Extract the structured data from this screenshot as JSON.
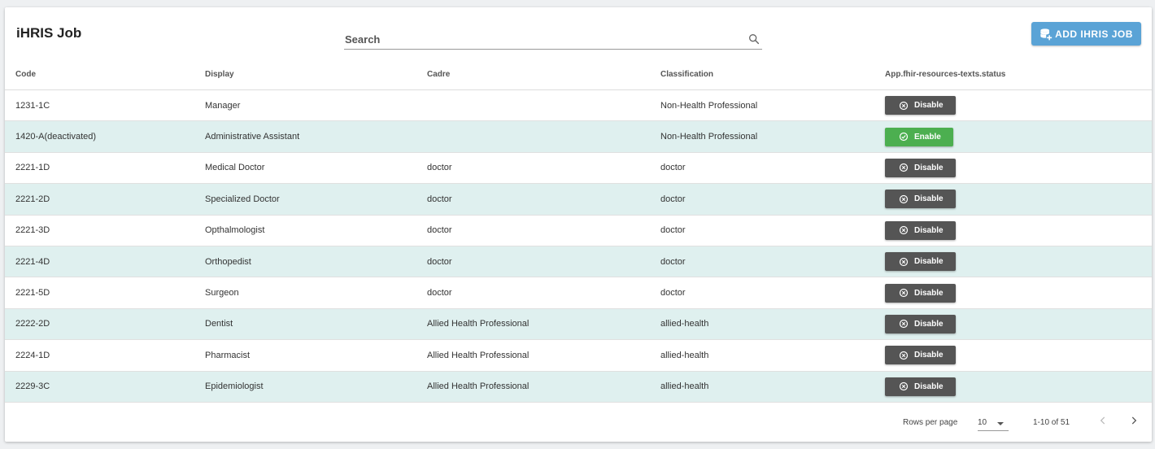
{
  "header": {
    "title": "iHRIS Job",
    "search_label": "Search",
    "add_button_label": "ADD IHRIS JOB"
  },
  "table": {
    "columns": [
      "Code",
      "Display",
      "Cadre",
      "Classification",
      "App.fhir-resources-texts.status"
    ],
    "rows": [
      {
        "code": "1231-1C",
        "display": "Manager",
        "cadre": "",
        "classification": "Non-Health Professional",
        "action": "Disable"
      },
      {
        "code": "1420-A(deactivated)",
        "display": "Administrative Assistant",
        "cadre": "",
        "classification": "Non-Health Professional",
        "action": "Enable"
      },
      {
        "code": "2221-1D",
        "display": "Medical Doctor",
        "cadre": "doctor",
        "classification": "doctor",
        "action": "Disable"
      },
      {
        "code": "2221-2D",
        "display": "Specialized Doctor",
        "cadre": "doctor",
        "classification": "doctor",
        "action": "Disable"
      },
      {
        "code": "2221-3D",
        "display": "Opthalmologist",
        "cadre": "doctor",
        "classification": "doctor",
        "action": "Disable"
      },
      {
        "code": "2221-4D",
        "display": "Orthopedist",
        "cadre": "doctor",
        "classification": "doctor",
        "action": "Disable"
      },
      {
        "code": "2221-5D",
        "display": "Surgeon",
        "cadre": "doctor",
        "classification": "doctor",
        "action": "Disable"
      },
      {
        "code": "2222-2D",
        "display": "Dentist",
        "cadre": "Allied Health Professional",
        "classification": "allied-health",
        "action": "Disable"
      },
      {
        "code": "2224-1D",
        "display": "Pharmacist",
        "cadre": "Allied Health Professional",
        "classification": "allied-health",
        "action": "Disable"
      },
      {
        "code": "2229-3C",
        "display": "Epidemiologist",
        "cadre": "Allied Health Professional",
        "classification": "allied-health",
        "action": "Disable"
      }
    ]
  },
  "footer": {
    "rows_per_page_label": "Rows per page",
    "rows_per_page_value": "10",
    "range_text": "1-10 of 51"
  },
  "colors": {
    "accent": "#5aa3d6",
    "row_alt": "#dff0ef",
    "disable_button": "#555555",
    "enable_button": "#4caf50"
  },
  "icons": {
    "search": "search-icon",
    "add": "database-plus-icon",
    "disable": "close-circle-icon",
    "enable": "check-circle-icon",
    "prev": "chevron-left-icon",
    "next": "chevron-right-icon",
    "select": "caret-down-icon"
  }
}
